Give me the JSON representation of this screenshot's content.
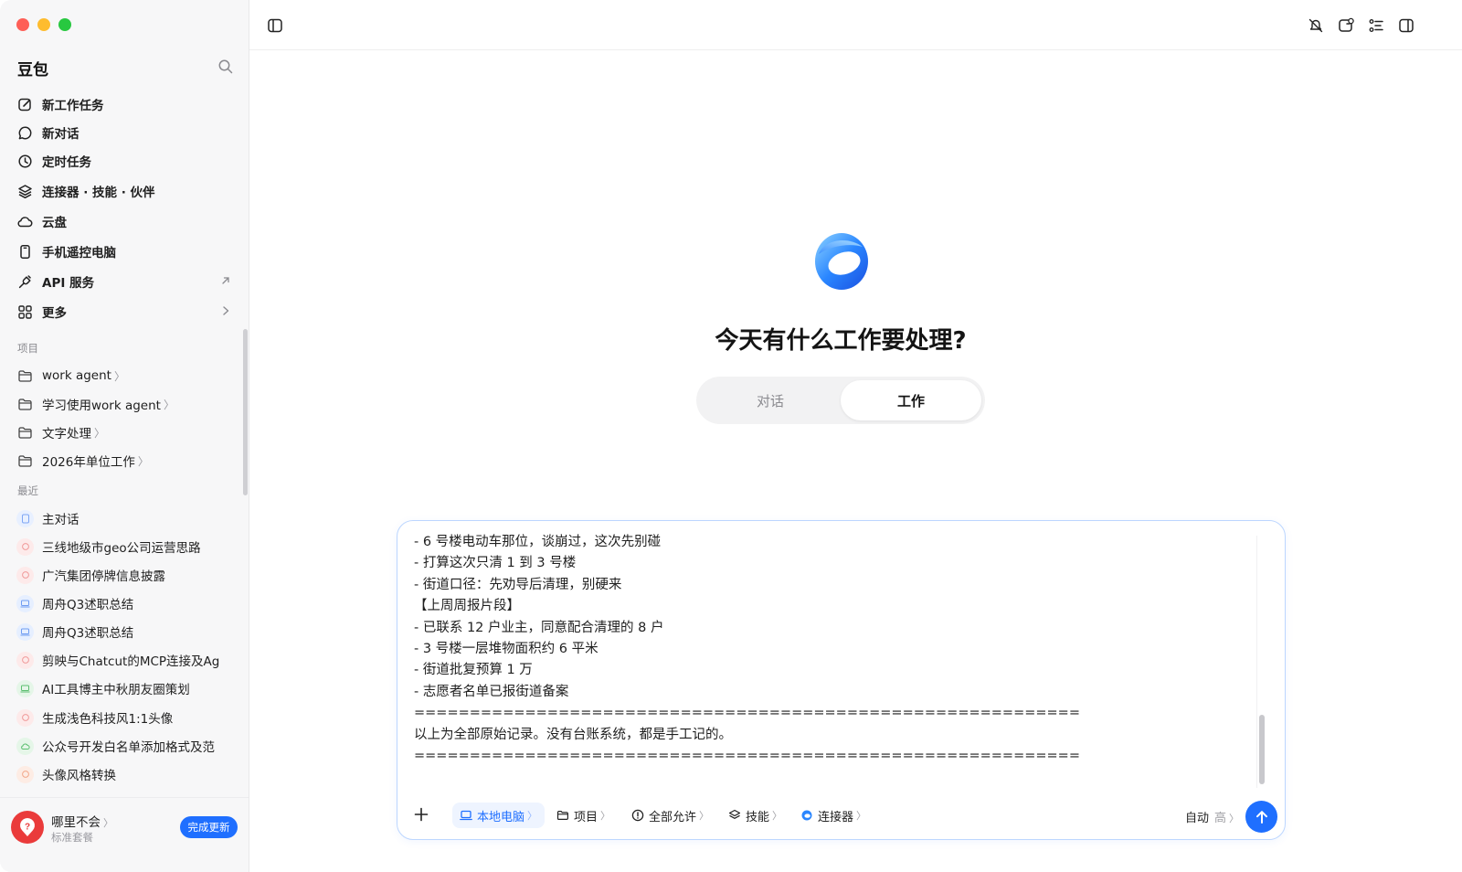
{
  "app": {
    "name": "豆包"
  },
  "sidebar": {
    "nav": [
      {
        "label": "新工作任务",
        "icon": "edit-icon"
      },
      {
        "label": "新对话",
        "icon": "chat-bubble-icon"
      },
      {
        "label": "定时任务",
        "icon": "clock-icon"
      },
      {
        "label": "连接器 · 技能 · 伙伴",
        "icon": "layers-icon"
      },
      {
        "label": "云盘",
        "icon": "cloud-icon"
      },
      {
        "label": "手机遥控电脑",
        "icon": "phone-icon"
      },
      {
        "label": "API 服务",
        "icon": "plug-icon"
      },
      {
        "label": "更多",
        "icon": "grid-icon"
      }
    ],
    "projects_label": "项目",
    "projects": [
      {
        "label": "work agent"
      },
      {
        "label": "学习使用work agent"
      },
      {
        "label": "文字处理"
      },
      {
        "label": "2026年单位工作"
      }
    ],
    "recent_label": "最近",
    "recent": [
      {
        "label": "主对话"
      },
      {
        "label": "三线地级市geo公司运营思路"
      },
      {
        "label": "广汽集团停牌信息披露"
      },
      {
        "label": "周舟Q3述职总结"
      },
      {
        "label": "周舟Q3述职总结"
      },
      {
        "label": "剪映与Chatcut的MCP连接及Ag"
      },
      {
        "label": "AI工具博主中秋朋友圈策划"
      },
      {
        "label": "生成浅色科技风1:1头像"
      },
      {
        "label": "公众号开发白名单添加格式及范"
      },
      {
        "label": "头像风格转换"
      }
    ],
    "account": {
      "name": "哪里不会",
      "plan": "标准套餐",
      "update_label": "完成更新"
    }
  },
  "main": {
    "headline": "今天有什么工作要处理?",
    "mode_tabs": [
      {
        "label": "对话",
        "active": false
      },
      {
        "label": "工作",
        "active": true
      }
    ],
    "composer": {
      "lines": [
        "- 6 号楼电动车那位，谈崩过，这次先别碰",
        "- 打算这次只清 1 到 3 号楼",
        "- 街道口径：先劝导后清理，别硬来",
        "【上周周报片段】",
        "- 已联系 12 户业主，同意配合清理的 8 户",
        "- 3 号楼一层堆物面积约 6 平米",
        "- 街道批复预算 1 万",
        "- 志愿者名单已报街道备案",
        "============================================================",
        "以上为全部原始记录。没有台账系统，都是手工记的。",
        "============================================================"
      ],
      "chips": [
        {
          "label": "本地电脑",
          "icon": "laptop-icon",
          "selected": true
        },
        {
          "label": "项目",
          "icon": "folder-icon",
          "selected": false
        },
        {
          "label": "全部允许",
          "icon": "alert-circle-icon",
          "selected": false
        },
        {
          "label": "技能",
          "icon": "layers-icon",
          "selected": false
        },
        {
          "label": "连接器",
          "icon": "connector-icon",
          "selected": false
        }
      ],
      "model_mode": "自动",
      "model_level": "高"
    }
  },
  "colors": {
    "accent": "#1f6fff",
    "sidebar_bg": "#f7f7f8"
  }
}
